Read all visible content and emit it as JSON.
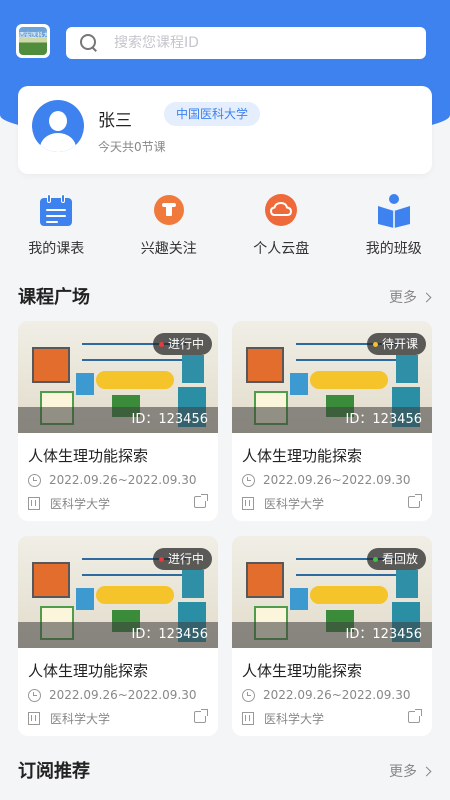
{
  "search": {
    "placeholder": "搜索您课程ID"
  },
  "profile": {
    "name": "张三",
    "school": "中国医科大学",
    "today_classes": "今天共0节课"
  },
  "quick_nav": [
    {
      "label": "我的课表",
      "icon": "calendar-icon"
    },
    {
      "label": "兴趣关注",
      "icon": "lightbulb-icon"
    },
    {
      "label": "个人云盘",
      "icon": "cloud-icon"
    },
    {
      "label": "我的班级",
      "icon": "class-book-icon"
    }
  ],
  "course_plaza": {
    "title": "课程广场",
    "more": "更多",
    "courses": [
      {
        "status": "进行中",
        "status_color": "#e83a3a",
        "id_text": "ID：123456",
        "title": "人体生理功能探索",
        "date": "2022.09.26~2022.09.30",
        "school": "医科学大学"
      },
      {
        "status": "待开课",
        "status_color": "#f2c12e",
        "id_text": "ID：123456",
        "title": "人体生理功能探索",
        "date": "2022.09.26~2022.09.30",
        "school": "医科学大学"
      },
      {
        "status": "进行中",
        "status_color": "#e83a3a",
        "id_text": "ID：123456",
        "title": "人体生理功能探索",
        "date": "2022.09.26~2022.09.30",
        "school": "医科学大学"
      },
      {
        "status": "看回放",
        "status_color": "#3fbf4a",
        "id_text": "ID：123456",
        "title": "人体生理功能探索",
        "date": "2022.09.26~2022.09.30",
        "school": "医科学大学"
      }
    ]
  },
  "subscription": {
    "title": "订阅推荐",
    "more": "更多"
  },
  "colors": {
    "primary": "#3e82f0",
    "orange": "#f07a3c"
  }
}
